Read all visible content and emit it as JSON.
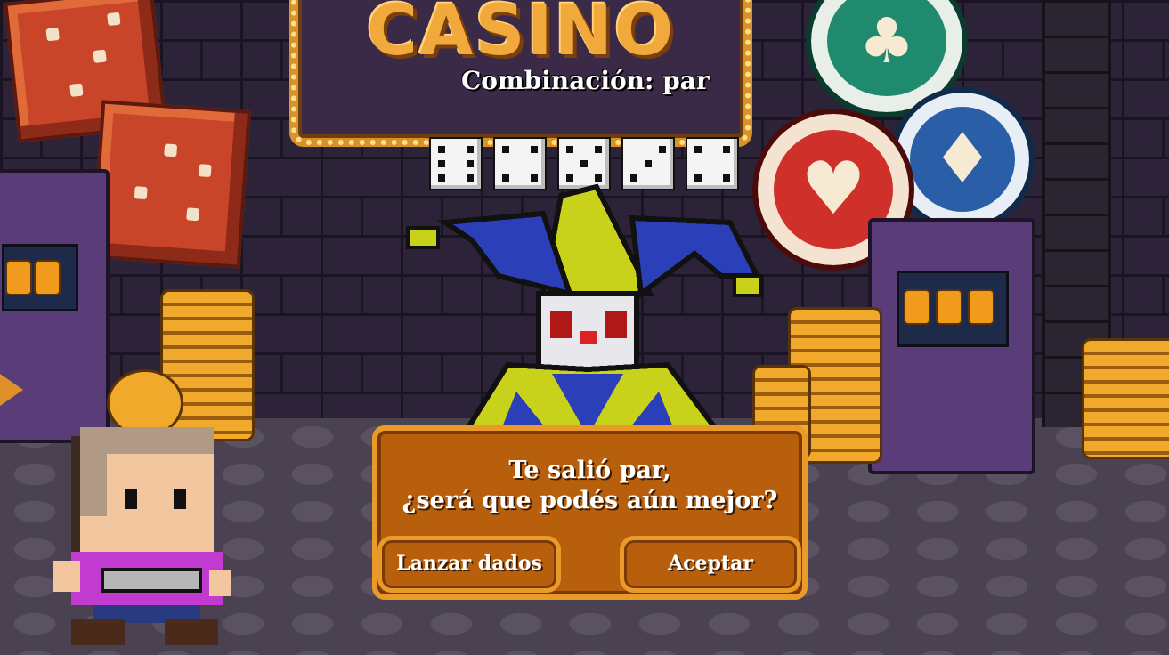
{
  "sign": {
    "title": "CASINO"
  },
  "combination_label": "Combinación: par",
  "dice": [
    6,
    4,
    5,
    3,
    4
  ],
  "dialog": {
    "line1": "Te salió par,",
    "line2": "¿será que podés aún mejor?"
  },
  "buttons": {
    "roll": "Lanzar dados",
    "accept": "Aceptar"
  },
  "colors": {
    "panel": "#b85f0d",
    "panel_border": "#e99a28",
    "sign_text": "#f2a93b"
  }
}
